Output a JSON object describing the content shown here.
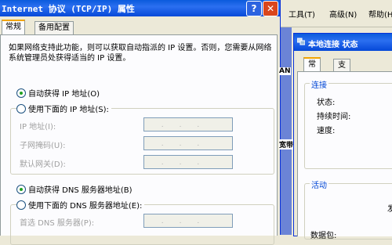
{
  "dialog": {
    "title": "Internet 协议 (TCP/IP) 属性",
    "help_btn": "?",
    "close_btn": "✕",
    "tabs": [
      "常规",
      "备用配置"
    ],
    "description": "如果网络支持此功能，则可以获取自动指派的 IP 设置。否则，您需要从网络系统管理员处获得适当的 IP 设置。",
    "auto_ip_label": "自动获得 IP 地址(O)",
    "manual_ip_label": "使用下面的 IP 地址(S):",
    "ip_address_label": "IP 地址(I):",
    "subnet_label": "子网掩码(U):",
    "gateway_label": "默认网关(D):",
    "auto_dns_label": "自动获得 DNS 服务器地址(B)",
    "manual_dns_label": "使用下面的 DNS 服务器地址(E):",
    "preferred_dns_label": "首选 DNS 服务器(P):",
    "field_dots": "...",
    "auto_ip_selected": true,
    "auto_dns_selected": true
  },
  "background": {
    "menu": [
      "工具(T)",
      "高级(N)",
      "帮助(H)"
    ],
    "side_fragments": [
      "AN",
      "宽带"
    ]
  },
  "status_window": {
    "title": "本地连接 状态",
    "tabs": [
      "常规",
      "支持"
    ],
    "connection_group": "连接",
    "status_label": "状态:",
    "duration_label": "持续时间:",
    "speed_label": "速度:",
    "activity_group": "活动",
    "sent_fragment": "发",
    "packets_fragment": "数据包:"
  },
  "colors": {
    "title_blue": "#0a5bdc",
    "dialog_bg": "#ece9d8",
    "panel_bg": "#fcfcfe",
    "group_legend": "#0046d5",
    "radio_selected": "#21a121"
  }
}
